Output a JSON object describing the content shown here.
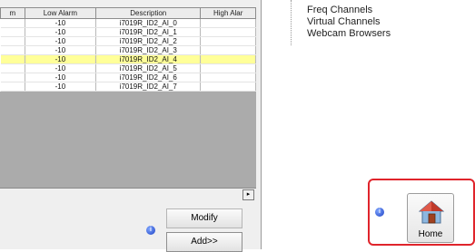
{
  "table": {
    "columns": [
      "m",
      "Low Alarm",
      "Description",
      "High Alar"
    ],
    "rows": [
      {
        "low": "-10",
        "desc": "i7019R_ID2_AI_0",
        "selected": false
      },
      {
        "low": "-10",
        "desc": "i7019R_ID2_AI_1",
        "selected": false
      },
      {
        "low": "-10",
        "desc": "i7019R_ID2_AI_2",
        "selected": false
      },
      {
        "low": "-10",
        "desc": "i7019R_ID2_AI_3",
        "selected": false
      },
      {
        "low": "-10",
        "desc": "i7019R_ID2_AI_4",
        "selected": true
      },
      {
        "low": "-10",
        "desc": "i7019R_ID2_AI_5",
        "selected": false
      },
      {
        "low": "-10",
        "desc": "i7019R_ID2_AI_6",
        "selected": false
      },
      {
        "low": "-10",
        "desc": "i7019R_ID2_AI_7",
        "selected": false
      }
    ]
  },
  "scroll": {
    "right_arrow": "▸"
  },
  "buttons": {
    "modify": "Modify",
    "add": "Add>>",
    "home": "Home"
  },
  "tree": {
    "items": [
      "Freq Channels",
      "Virtual Channels",
      "Webcam Browsers"
    ]
  },
  "colors": {
    "selected_row": "#ffff99",
    "highlight_box": "#e0242b",
    "info_icon": "#1c40c4"
  },
  "icons": {
    "info": "info-icon",
    "home": "home-icon"
  }
}
